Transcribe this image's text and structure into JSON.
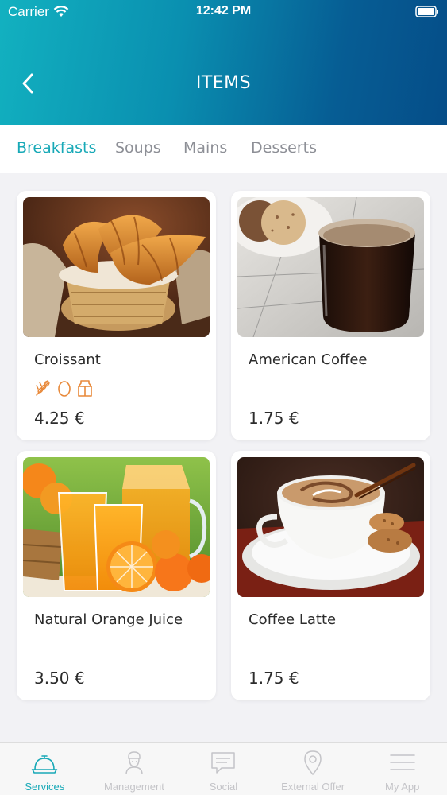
{
  "status_bar": {
    "carrier": "Carrier",
    "time": "12:42 PM"
  },
  "header": {
    "title": "ITEMS"
  },
  "tabs": [
    {
      "label": "Breakfasts",
      "active": true
    },
    {
      "label": "Soups",
      "active": false
    },
    {
      "label": "Mains",
      "active": false
    },
    {
      "label": "Desserts",
      "active": false
    }
  ],
  "items": [
    {
      "name": "Croissant",
      "price": "4.25 €",
      "allergens": [
        "wheat-icon",
        "egg-icon",
        "milk-icon"
      ],
      "image": "croissant-image"
    },
    {
      "name": "American Coffee",
      "price": "1.75 €",
      "allergens": [],
      "image": "american-coffee-image"
    },
    {
      "name": "Natural Orange Juice",
      "price": "3.50 €",
      "allergens": [],
      "image": "orange-juice-image"
    },
    {
      "name": "Coffee Latte",
      "price": "1.75 €",
      "allergens": [],
      "image": "coffee-latte-image"
    }
  ],
  "tab_bar": [
    {
      "label": "Services",
      "icon": "cloche-icon",
      "active": true
    },
    {
      "label": "Management",
      "icon": "person-icon",
      "active": false
    },
    {
      "label": "Social",
      "icon": "chat-icon",
      "active": false
    },
    {
      "label": "External Offer",
      "icon": "location-pin-icon",
      "active": false
    },
    {
      "label": "My App",
      "icon": "menu-icon",
      "active": false
    }
  ],
  "colors": {
    "accent": "#18a9b7",
    "allergen": "#e8893a",
    "header_start": "#12b1c0",
    "header_end": "#054d88"
  }
}
